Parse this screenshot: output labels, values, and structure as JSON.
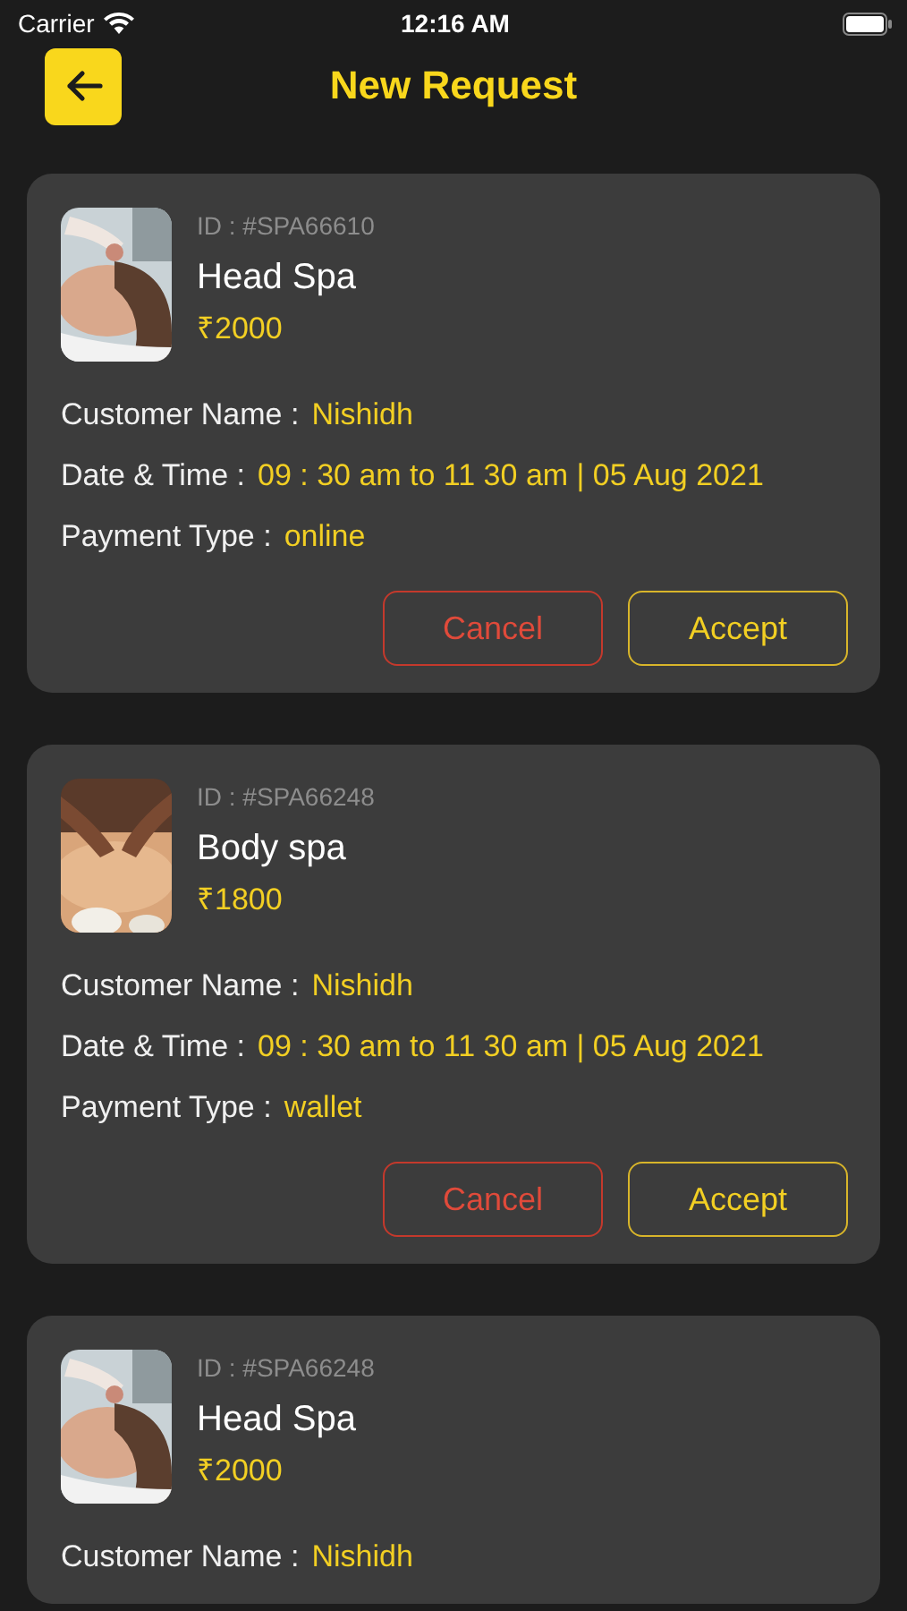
{
  "status_bar": {
    "carrier": "Carrier",
    "time": "12:16 AM"
  },
  "header": {
    "title": "New Request"
  },
  "requests": [
    {
      "id": "ID : #SPA66610",
      "service": "Head Spa",
      "price": "₹2000",
      "fields": [
        {
          "label": "Customer Name :",
          "value": "Nishidh"
        },
        {
          "label": "Date & Time :",
          "value": "09 : 30 am to 11 30 am | 05 Aug 2021"
        },
        {
          "label": "Payment Type :",
          "value": "online"
        }
      ],
      "actions": [
        {
          "label": "Cancel",
          "kind": "cancel"
        },
        {
          "label": "Accept",
          "kind": "accept"
        }
      ]
    },
    {
      "id": "ID : #SPA66248",
      "service": "Body spa",
      "price": "₹1800",
      "fields": [
        {
          "label": "Customer Name :",
          "value": "Nishidh"
        },
        {
          "label": "Date & Time :",
          "value": "09 : 30 am to 11 30 am | 05 Aug 2021"
        },
        {
          "label": "Payment Type :",
          "value": "wallet"
        }
      ],
      "actions": [
        {
          "label": "Cancel",
          "kind": "cancel"
        },
        {
          "label": "Accept",
          "kind": "accept"
        }
      ]
    },
    {
      "id": "ID : #SPA66248",
      "service": "Head Spa",
      "price": "₹2000",
      "fields": [
        {
          "label": "Customer Name :",
          "value": "Nishidh"
        }
      ]
    }
  ]
}
